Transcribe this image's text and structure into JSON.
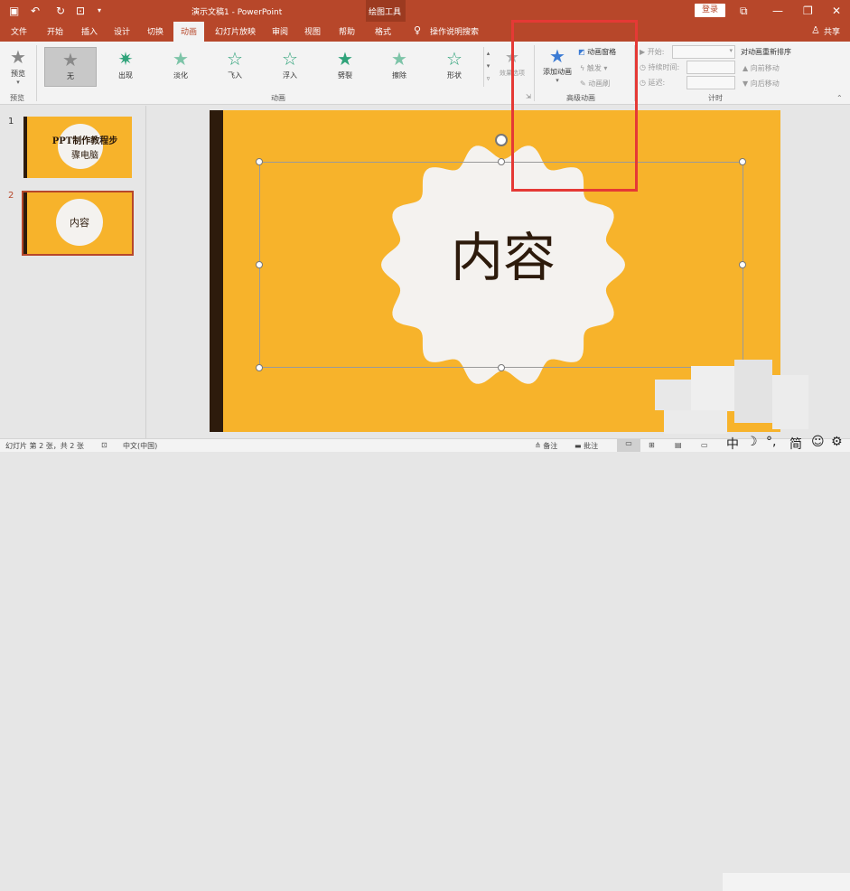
{
  "app": {
    "doc_title": "演示文稿1 - PowerPoint",
    "contextual_tab_group": "绘图工具",
    "login_label": "登录",
    "share_label": "共享",
    "tell_me": "操作说明搜索"
  },
  "tabs": [
    "文件",
    "开始",
    "插入",
    "设计",
    "切换",
    "动画",
    "幻灯片放映",
    "审阅",
    "视图",
    "帮助",
    "格式"
  ],
  "active_tab": "动画",
  "ribbon": {
    "preview": {
      "label": "预览",
      "group": "预览"
    },
    "animations": {
      "group": "动画",
      "items": [
        "无",
        "出现",
        "淡化",
        "飞入",
        "浮入",
        "劈裂",
        "擦除",
        "形状"
      ],
      "effect_options": "效果选项"
    },
    "advanced": {
      "group": "高级动画",
      "add_animation": "添加动画",
      "animation_pane": "动画窗格",
      "trigger": "触发",
      "painter": "动画刷"
    },
    "timing": {
      "group": "计时",
      "start": "开始:",
      "duration": "持续时间:",
      "delay": "延迟:",
      "reorder": "对动画重新排序",
      "move_earlier": "向前移动",
      "move_later": "向后移动"
    }
  },
  "thumbnails": [
    {
      "num": "1",
      "line1": "PPT制作教程步",
      "line2": "骤电脑"
    },
    {
      "num": "2",
      "text": "内容"
    }
  ],
  "slide": {
    "text": "内容"
  },
  "status": {
    "slide_info": "幻灯片 第 2 张，共 2 张",
    "language": "中文(中国)",
    "notes": "备注",
    "comments": "批注",
    "ime": [
      "中",
      "简"
    ]
  },
  "colors": {
    "accent": "#b7472a",
    "slide_bg": "#f7b32b",
    "slide_bar": "#2d1b0c",
    "highlight_box": "#e53935"
  }
}
